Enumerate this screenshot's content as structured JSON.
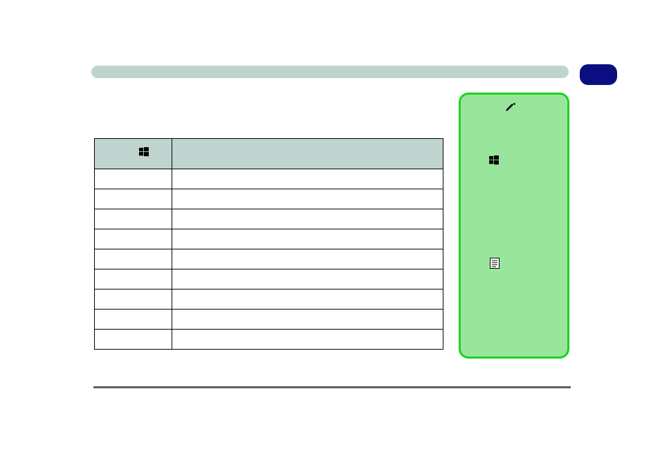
{
  "header": {
    "title": ""
  },
  "badge": {
    "label": ""
  },
  "table": {
    "columns": [
      {
        "label": "",
        "icon": "windows-icon"
      },
      {
        "label": ""
      }
    ],
    "rows": [
      [
        "",
        ""
      ],
      [
        "",
        ""
      ],
      [
        "",
        ""
      ],
      [
        "",
        ""
      ],
      [
        "",
        ""
      ],
      [
        "",
        ""
      ],
      [
        "",
        ""
      ],
      [
        "",
        ""
      ],
      [
        "",
        ""
      ]
    ]
  },
  "sidebar": {
    "icon_top": "pen-icon",
    "icon_mid": "windows-icon",
    "icon_doc": "document-icon"
  }
}
